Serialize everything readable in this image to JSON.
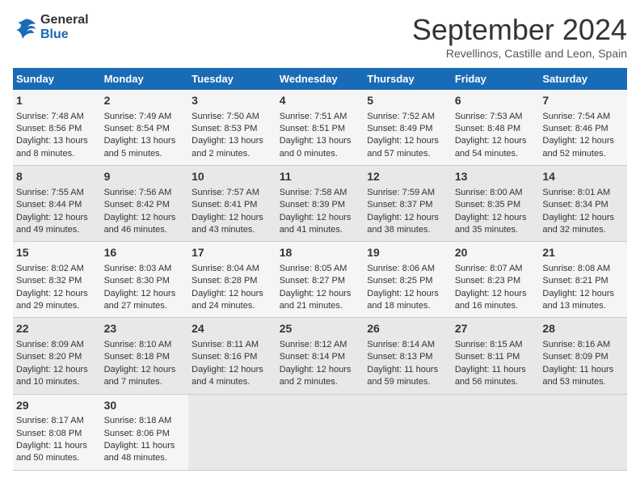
{
  "logo": {
    "line1": "General",
    "line2": "Blue"
  },
  "title": "September 2024",
  "subtitle": "Revellinos, Castille and Leon, Spain",
  "days_header": [
    "Sunday",
    "Monday",
    "Tuesday",
    "Wednesday",
    "Thursday",
    "Friday",
    "Saturday"
  ],
  "weeks": [
    [
      {
        "day": "1",
        "sunrise": "7:48 AM",
        "sunset": "8:56 PM",
        "daylight": "13 hours and 8 minutes."
      },
      {
        "day": "2",
        "sunrise": "7:49 AM",
        "sunset": "8:54 PM",
        "daylight": "13 hours and 5 minutes."
      },
      {
        "day": "3",
        "sunrise": "7:50 AM",
        "sunset": "8:53 PM",
        "daylight": "13 hours and 2 minutes."
      },
      {
        "day": "4",
        "sunrise": "7:51 AM",
        "sunset": "8:51 PM",
        "daylight": "13 hours and 0 minutes."
      },
      {
        "day": "5",
        "sunrise": "7:52 AM",
        "sunset": "8:49 PM",
        "daylight": "12 hours and 57 minutes."
      },
      {
        "day": "6",
        "sunrise": "7:53 AM",
        "sunset": "8:48 PM",
        "daylight": "12 hours and 54 minutes."
      },
      {
        "day": "7",
        "sunrise": "7:54 AM",
        "sunset": "8:46 PM",
        "daylight": "12 hours and 52 minutes."
      }
    ],
    [
      {
        "day": "8",
        "sunrise": "7:55 AM",
        "sunset": "8:44 PM",
        "daylight": "12 hours and 49 minutes."
      },
      {
        "day": "9",
        "sunrise": "7:56 AM",
        "sunset": "8:42 PM",
        "daylight": "12 hours and 46 minutes."
      },
      {
        "day": "10",
        "sunrise": "7:57 AM",
        "sunset": "8:41 PM",
        "daylight": "12 hours and 43 minutes."
      },
      {
        "day": "11",
        "sunrise": "7:58 AM",
        "sunset": "8:39 PM",
        "daylight": "12 hours and 41 minutes."
      },
      {
        "day": "12",
        "sunrise": "7:59 AM",
        "sunset": "8:37 PM",
        "daylight": "12 hours and 38 minutes."
      },
      {
        "day": "13",
        "sunrise": "8:00 AM",
        "sunset": "8:35 PM",
        "daylight": "12 hours and 35 minutes."
      },
      {
        "day": "14",
        "sunrise": "8:01 AM",
        "sunset": "8:34 PM",
        "daylight": "12 hours and 32 minutes."
      }
    ],
    [
      {
        "day": "15",
        "sunrise": "8:02 AM",
        "sunset": "8:32 PM",
        "daylight": "12 hours and 29 minutes."
      },
      {
        "day": "16",
        "sunrise": "8:03 AM",
        "sunset": "8:30 PM",
        "daylight": "12 hours and 27 minutes."
      },
      {
        "day": "17",
        "sunrise": "8:04 AM",
        "sunset": "8:28 PM",
        "daylight": "12 hours and 24 minutes."
      },
      {
        "day": "18",
        "sunrise": "8:05 AM",
        "sunset": "8:27 PM",
        "daylight": "12 hours and 21 minutes."
      },
      {
        "day": "19",
        "sunrise": "8:06 AM",
        "sunset": "8:25 PM",
        "daylight": "12 hours and 18 minutes."
      },
      {
        "day": "20",
        "sunrise": "8:07 AM",
        "sunset": "8:23 PM",
        "daylight": "12 hours and 16 minutes."
      },
      {
        "day": "21",
        "sunrise": "8:08 AM",
        "sunset": "8:21 PM",
        "daylight": "12 hours and 13 minutes."
      }
    ],
    [
      {
        "day": "22",
        "sunrise": "8:09 AM",
        "sunset": "8:20 PM",
        "daylight": "12 hours and 10 minutes."
      },
      {
        "day": "23",
        "sunrise": "8:10 AM",
        "sunset": "8:18 PM",
        "daylight": "12 hours and 7 minutes."
      },
      {
        "day": "24",
        "sunrise": "8:11 AM",
        "sunset": "8:16 PM",
        "daylight": "12 hours and 4 minutes."
      },
      {
        "day": "25",
        "sunrise": "8:12 AM",
        "sunset": "8:14 PM",
        "daylight": "12 hours and 2 minutes."
      },
      {
        "day": "26",
        "sunrise": "8:14 AM",
        "sunset": "8:13 PM",
        "daylight": "11 hours and 59 minutes."
      },
      {
        "day": "27",
        "sunrise": "8:15 AM",
        "sunset": "8:11 PM",
        "daylight": "11 hours and 56 minutes."
      },
      {
        "day": "28",
        "sunrise": "8:16 AM",
        "sunset": "8:09 PM",
        "daylight": "11 hours and 53 minutes."
      }
    ],
    [
      {
        "day": "29",
        "sunrise": "8:17 AM",
        "sunset": "8:08 PM",
        "daylight": "11 hours and 50 minutes."
      },
      {
        "day": "30",
        "sunrise": "8:18 AM",
        "sunset": "8:06 PM",
        "daylight": "11 hours and 48 minutes."
      },
      null,
      null,
      null,
      null,
      null
    ]
  ],
  "labels": {
    "sunrise": "Sunrise:",
    "sunset": "Sunset:",
    "daylight": "Daylight:"
  }
}
